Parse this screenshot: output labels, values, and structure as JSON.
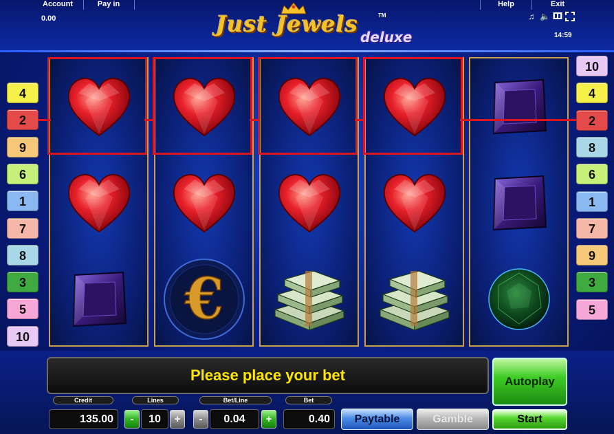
{
  "menu": {
    "account_label": "Account",
    "payin_label": "Pay in",
    "help_label": "Help",
    "exit_label": "Exit",
    "balance": "0.00",
    "clock": "14:59"
  },
  "logo": {
    "title": "Just Jewels",
    "subtitle": "deluxe",
    "tm": "TM"
  },
  "icons": {
    "music": "music-icon",
    "sound": "speaker-icon",
    "screen": "screen-icon",
    "fullscreen": "fullscreen-icon"
  },
  "reels": [
    [
      "heart",
      "heart",
      "purple-gem"
    ],
    [
      "heart",
      "heart",
      "euro-coin"
    ],
    [
      "heart",
      "heart",
      "money-stack"
    ],
    [
      "heart",
      "heart",
      "money-stack"
    ],
    [
      "purple-gem",
      "purple-gem",
      "green-gem"
    ]
  ],
  "left_lines": [
    {
      "num": "4",
      "color": "#f5f04a"
    },
    {
      "num": "2",
      "color": "#e44a4a"
    },
    {
      "num": "9",
      "color": "#f7c77a"
    },
    {
      "num": "6",
      "color": "#c6f07a"
    },
    {
      "num": "1",
      "color": "#8ab8f0"
    },
    {
      "num": "7",
      "color": "#f5b8a8"
    },
    {
      "num": "8",
      "color": "#a8d8e8"
    },
    {
      "num": "3",
      "color": "#3faa3f"
    },
    {
      "num": "5",
      "color": "#f5a8d8"
    },
    {
      "num": "10",
      "color": "#e8c8f5"
    }
  ],
  "right_lines": [
    {
      "num": "10",
      "color": "#e8c8f5"
    },
    {
      "num": "4",
      "color": "#f5f04a"
    },
    {
      "num": "2",
      "color": "#e44a4a"
    },
    {
      "num": "8",
      "color": "#a8d8e8"
    },
    {
      "num": "6",
      "color": "#c6f07a"
    },
    {
      "num": "1",
      "color": "#8ab8f0"
    },
    {
      "num": "7",
      "color": "#f5b8a8"
    },
    {
      "num": "9",
      "color": "#f7c77a"
    },
    {
      "num": "3",
      "color": "#3faa3f"
    },
    {
      "num": "5",
      "color": "#f5a8d8"
    }
  ],
  "message": "Please place your bet",
  "controls": {
    "credit_label": "Credit",
    "credit_value": "135.00",
    "lines_label": "Lines",
    "lines_value": "10",
    "betline_label": "Bet/Line",
    "betline_value": "0.04",
    "bet_label": "Bet",
    "bet_value": "0.40",
    "minus": "-",
    "plus": "+",
    "paytable": "Paytable",
    "gamble": "Gamble",
    "autoplay": "Autoplay",
    "start": "Start"
  }
}
